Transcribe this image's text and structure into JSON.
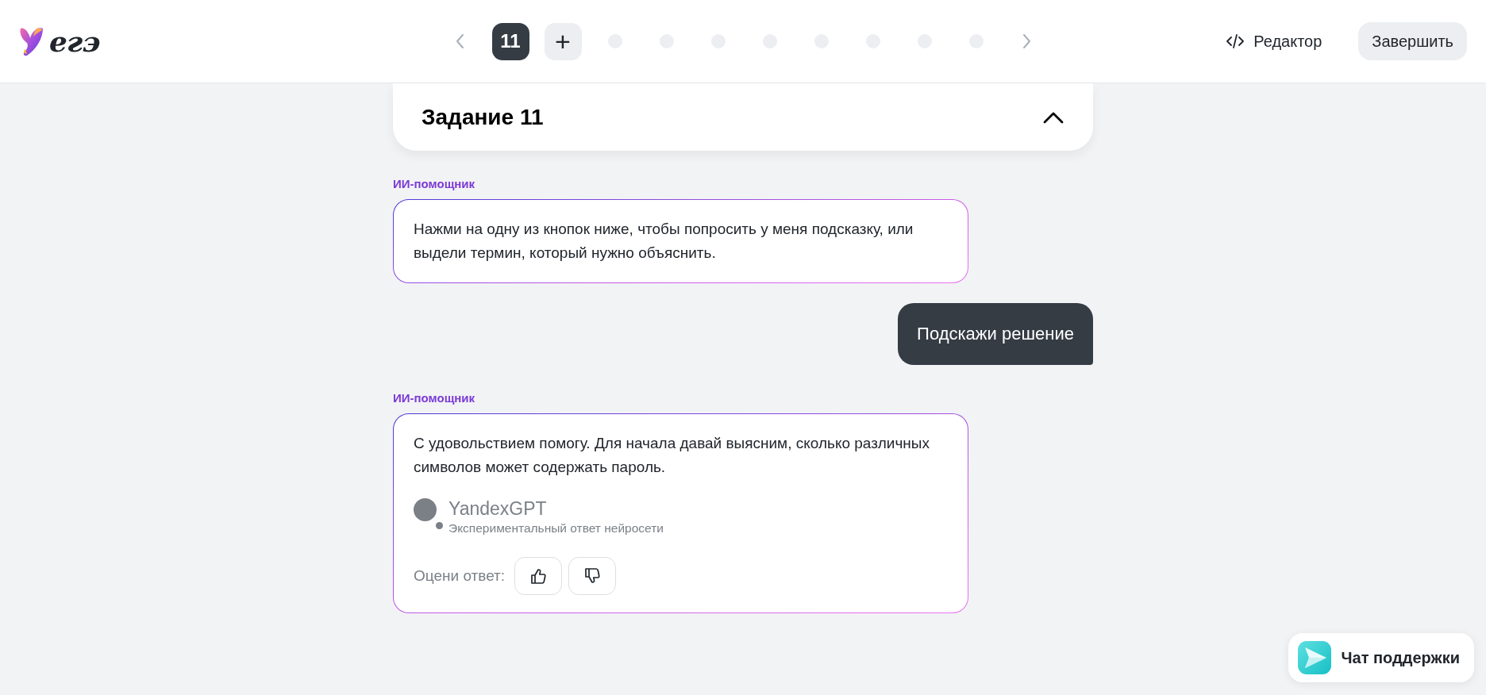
{
  "header": {
    "logo_text": "егэ",
    "pager": {
      "items": [
        {
          "kind": "number",
          "label": "11",
          "selected": true
        },
        {
          "kind": "add",
          "label": "+",
          "selected": false
        },
        {
          "kind": "dot",
          "selected": false
        },
        {
          "kind": "dot",
          "selected": false
        },
        {
          "kind": "dot",
          "selected": false
        },
        {
          "kind": "dot",
          "selected": false
        },
        {
          "kind": "dot",
          "selected": false
        },
        {
          "kind": "dot",
          "selected": false
        },
        {
          "kind": "dot",
          "selected": false
        },
        {
          "kind": "dot",
          "selected": false
        }
      ]
    },
    "editor_link": "Редактор",
    "finish_button": "Завершить"
  },
  "task": {
    "title": "Задание 11",
    "expanded": true
  },
  "messages": [
    {
      "kind": "assistant",
      "author": "ИИ-помощник",
      "text": "Нажми на одну из кнопок ниже, чтобы попросить у меня подсказку, или выдели термин, который нужно объяснить."
    },
    {
      "kind": "user",
      "text": "Подскажи решение"
    },
    {
      "kind": "assistant",
      "author": "ИИ-помощник",
      "text": "С удовольствием помогу. Для начала давай выясним, сколько различных символов может содержать пароль.",
      "model": {
        "name": "YandexGPT",
        "note": "Экспериментальный ответ нейросети"
      },
      "rating": {
        "label": "Оцени ответ:"
      }
    }
  ],
  "support_chat": {
    "label": "Чат поддержки"
  }
}
